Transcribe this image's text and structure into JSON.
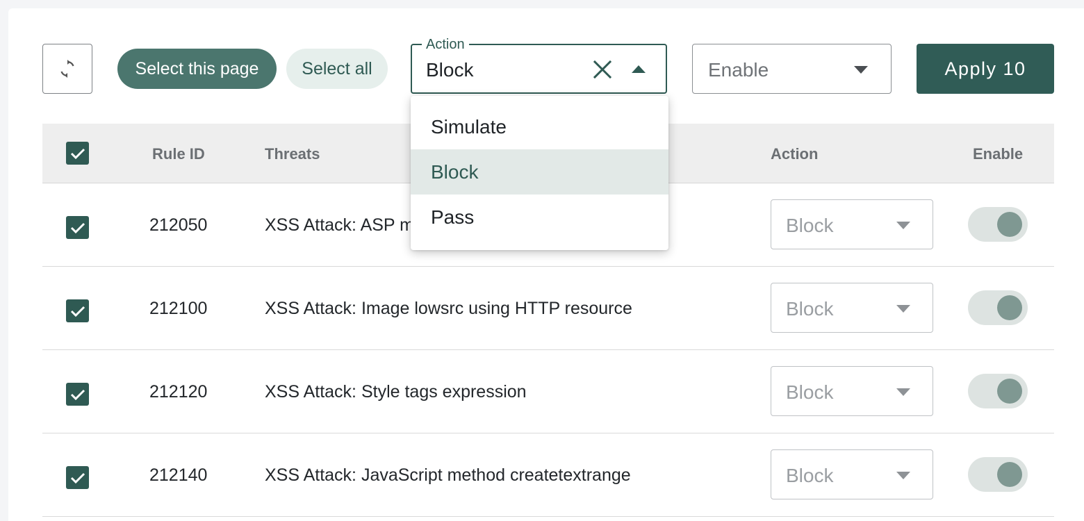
{
  "toolbar": {
    "select_page_label": "Select this page",
    "select_all_label": "Select all",
    "action_field": {
      "legend": "Action",
      "value": "Block",
      "options": [
        "Simulate",
        "Block",
        "Pass"
      ],
      "selected_option": "Block"
    },
    "enable_field": {
      "value": "Enable"
    },
    "apply_label": "Apply 10"
  },
  "table": {
    "headers": {
      "rule_id": "Rule ID",
      "threats": "Threats",
      "action": "Action",
      "enable": "Enable"
    },
    "rows": [
      {
        "rule_id": "212050",
        "threat": "XSS Attack: ASP m",
        "action": "Block",
        "checked": true,
        "enabled": true
      },
      {
        "rule_id": "212100",
        "threat": "XSS Attack: Image lowsrc using HTTP resource",
        "action": "Block",
        "checked": true,
        "enabled": true
      },
      {
        "rule_id": "212120",
        "threat": "XSS Attack: Style tags expression",
        "action": "Block",
        "checked": true,
        "enabled": true
      },
      {
        "rule_id": "212140",
        "threat": "XSS Attack: JavaScript method createtextrange",
        "action": "Block",
        "checked": true,
        "enabled": true
      }
    ]
  },
  "colors": {
    "primary": "#305c56",
    "pill_primary": "#4b766e",
    "pill_secondary_bg": "#e6efec",
    "menu_selected_bg": "#e2e9e7"
  }
}
